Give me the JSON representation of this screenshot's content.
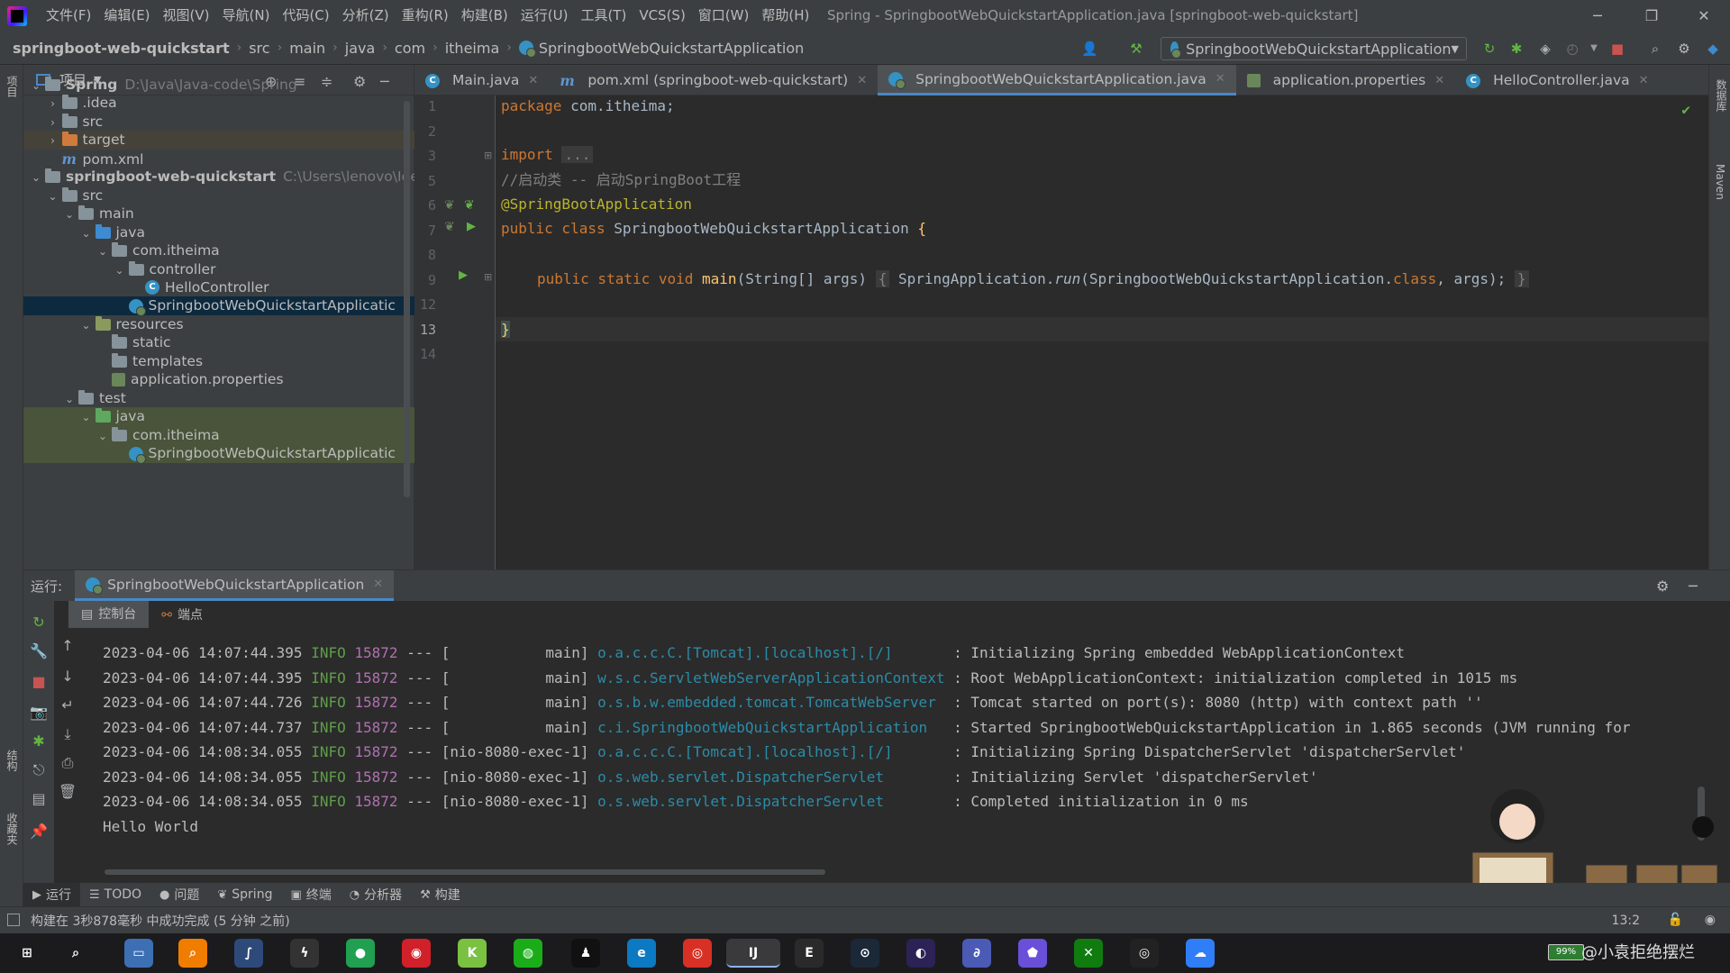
{
  "titlebar": {
    "menus": [
      "文件(F)",
      "编辑(E)",
      "视图(V)",
      "导航(N)",
      "代码(C)",
      "分析(Z)",
      "重构(R)",
      "构建(B)",
      "运行(U)",
      "工具(T)",
      "VCS(S)",
      "窗口(W)",
      "帮助(H)"
    ],
    "window_title": "Spring - SpringbootWebQuickstartApplication.java [springboot-web-quickstart]"
  },
  "navbar": {
    "breadcrumbs": [
      "springboot-web-quickstart",
      "src",
      "main",
      "java",
      "com",
      "itheima",
      "SpringbootWebQuickstartApplication"
    ],
    "run_config": "SpringbootWebQuickstartApplication"
  },
  "left_strip": {
    "labels": [
      "项目",
      "结构",
      "收藏夹"
    ]
  },
  "right_strip": {
    "labels": [
      "数据库",
      "Maven"
    ]
  },
  "project": {
    "title": "项目",
    "tree": [
      {
        "label": "Spring",
        "path": "D:\\Java\\Java-code\\Spring",
        "depth": 0,
        "arrow": "v",
        "icon": "folder",
        "bold": true
      },
      {
        "label": ".idea",
        "depth": 1,
        "arrow": ">",
        "icon": "folder"
      },
      {
        "label": "src",
        "depth": 1,
        "arrow": ">",
        "icon": "folder"
      },
      {
        "label": "target",
        "depth": 1,
        "arrow": ">",
        "icon": "folder-orange",
        "style": "excluded"
      },
      {
        "label": "pom.xml",
        "depth": 1,
        "arrow": "",
        "icon": "maven"
      },
      {
        "label": "springboot-web-quickstart",
        "path": "C:\\Users\\lenovo\\IdeaPr",
        "depth": 0,
        "arrow": "v",
        "icon": "folder",
        "bold": true
      },
      {
        "label": "src",
        "depth": 1,
        "arrow": "v",
        "icon": "folder"
      },
      {
        "label": "main",
        "depth": 2,
        "arrow": "v",
        "icon": "folder"
      },
      {
        "label": "java",
        "depth": 3,
        "arrow": "v",
        "icon": "folder-blue"
      },
      {
        "label": "com.itheima",
        "depth": 4,
        "arrow": "v",
        "icon": "folder"
      },
      {
        "label": "controller",
        "depth": 5,
        "arrow": "v",
        "icon": "folder"
      },
      {
        "label": "HelloController",
        "depth": 6,
        "arrow": "",
        "icon": "class"
      },
      {
        "label": "SpringbootWebQuickstartApplicatic",
        "depth": 6,
        "arrow": "",
        "icon": "spring",
        "style": "selected",
        "indent_override": 5
      },
      {
        "label": "resources",
        "depth": 3,
        "arrow": "v",
        "icon": "folder-res"
      },
      {
        "label": "static",
        "depth": 4,
        "arrow": "",
        "icon": "folder"
      },
      {
        "label": "templates",
        "depth": 4,
        "arrow": "",
        "icon": "folder"
      },
      {
        "label": "application.properties",
        "depth": 4,
        "arrow": "",
        "icon": "props"
      },
      {
        "label": "test",
        "depth": 2,
        "arrow": "v",
        "icon": "folder"
      },
      {
        "label": "java",
        "depth": 3,
        "arrow": "v",
        "icon": "folder-green",
        "style": "test"
      },
      {
        "label": "com.itheima",
        "depth": 4,
        "arrow": "v",
        "icon": "folder",
        "style": "test"
      },
      {
        "label": "SpringbootWebQuickstartApplicatic",
        "depth": 5,
        "arrow": "",
        "icon": "spring",
        "style": "test"
      }
    ]
  },
  "editor": {
    "tabs": [
      {
        "label": "Main.java",
        "icon": "class",
        "active": false
      },
      {
        "label": "pom.xml (springboot-web-quickstart)",
        "icon": "maven",
        "active": false
      },
      {
        "label": "SpringbootWebQuickstartApplication.java",
        "icon": "spring",
        "active": true
      },
      {
        "label": "application.properties",
        "icon": "props",
        "active": false
      },
      {
        "label": "HelloController.java",
        "icon": "class",
        "active": false
      }
    ],
    "line_numbers": [
      "1",
      "2",
      "3",
      "5",
      "6",
      "7",
      "8",
      "9",
      "12",
      "13",
      "14"
    ],
    "current_line": "13",
    "code": {
      "l1_kw": "package",
      "l1_rest": " com.itheima;",
      "l3_kw": "import",
      "l3_fold": "...",
      "l5_comment": "//启动类 -- 启动SpringBoot工程",
      "l6_annotation": "@SpringBootApplication",
      "l7_kw": "public class",
      "l7_name": " SpringbootWebQuickstartApplication ",
      "l7_brace": "{",
      "l9_kw": "public static void",
      "l9_fn": "main",
      "l9_args": "(String[] args) ",
      "l9_fold_open": "{",
      "l9_call": " SpringApplication.",
      "l9_run": "run",
      "l9_params": "(SpringbootWebQuickstartApplication.",
      "l9_class": "class",
      "l9_tail": ", args);",
      "l9_fold_close": "}",
      "l13_brace": "}"
    }
  },
  "run": {
    "label": "运行:",
    "tab": "SpringbootWebQuickstartApplication",
    "subtabs": [
      "控制台",
      "端点"
    ],
    "logs": [
      {
        "ts": "2023-04-06 14:07:44.395",
        "level": "INFO",
        "pid": "15872",
        "sep": "---",
        "thread": "[           main]",
        "logger": "o.a.c.c.C.[Tomcat].[localhost].[/]      ",
        "msg": ": Initializing Spring embedded WebApplicationContext"
      },
      {
        "ts": "2023-04-06 14:07:44.395",
        "level": "INFO",
        "pid": "15872",
        "sep": "---",
        "thread": "[           main]",
        "logger": "w.s.c.ServletWebServerApplicationContext",
        "msg": ": Root WebApplicationContext: initialization completed in 1015 ms"
      },
      {
        "ts": "2023-04-06 14:07:44.726",
        "level": "INFO",
        "pid": "15872",
        "sep": "---",
        "thread": "[           main]",
        "logger": "o.s.b.w.embedded.tomcat.TomcatWebServer ",
        "msg": ": Tomcat started on port(s): 8080 (http) with context path ''"
      },
      {
        "ts": "2023-04-06 14:07:44.737",
        "level": "INFO",
        "pid": "15872",
        "sep": "---",
        "thread": "[           main]",
        "logger": "c.i.SpringbootWebQuickstartApplication  ",
        "msg": ": Started SpringbootWebQuickstartApplication in 1.865 seconds (JVM running for"
      },
      {
        "ts": "2023-04-06 14:08:34.055",
        "level": "INFO",
        "pid": "15872",
        "sep": "---",
        "thread": "[nio-8080-exec-1]",
        "logger": "o.a.c.c.C.[Tomcat].[localhost].[/]      ",
        "msg": ": Initializing Spring DispatcherServlet 'dispatcherServlet'"
      },
      {
        "ts": "2023-04-06 14:08:34.055",
        "level": "INFO",
        "pid": "15872",
        "sep": "---",
        "thread": "[nio-8080-exec-1]",
        "logger": "o.s.web.servlet.DispatcherServlet       ",
        "msg": ": Initializing Servlet 'dispatcherServlet'"
      },
      {
        "ts": "2023-04-06 14:08:34.055",
        "level": "INFO",
        "pid": "15872",
        "sep": "---",
        "thread": "[nio-8080-exec-1]",
        "logger": "o.s.web.servlet.DispatcherServlet       ",
        "msg": ": Completed initialization in 0 ms"
      }
    ],
    "output": "Hello World"
  },
  "bottom_tabs": [
    {
      "label": "运行",
      "icon": "▶",
      "active": true
    },
    {
      "label": "TODO",
      "icon": "☰",
      "active": false
    },
    {
      "label": "问题",
      "icon": "●",
      "active": false
    },
    {
      "label": "Spring",
      "icon": "❦",
      "active": false
    },
    {
      "label": "终端",
      "icon": "▣",
      "active": false
    },
    {
      "label": "分析器",
      "icon": "◔",
      "active": false
    },
    {
      "label": "构建",
      "icon": "⚒",
      "active": false
    }
  ],
  "status": {
    "message": "构建在 3秒878毫秒 中成功完成 (5 分钟 之前)",
    "cursor": "13:2"
  },
  "taskbar": {
    "tray_text": "@小袁拒绝摆烂",
    "battery": "99%",
    "apps": [
      "windows-icon",
      "search-icon",
      "explorer-icon",
      "everything-icon",
      "obsidian-icon",
      "thunder-icon",
      "green-app-icon",
      "netease-music-icon",
      "kook-icon",
      "wechat-icon",
      "qq-icon",
      "edge-icon",
      "chrome-icon",
      "intellij-icon",
      "epic-games-icon",
      "steam-icon",
      "eclipse-icon",
      "dolphin-icon",
      "pentagon-app-icon",
      "xbox-icon",
      "ubisoft-icon",
      "baidu-netdisk-icon"
    ]
  },
  "colors": {
    "accent": "#4a88c7",
    "bg_editor": "#2b2b2b",
    "bg_panel": "#3c3f41",
    "keyword": "#cc7832",
    "annotation": "#bbb529",
    "log_level": "#5f9e4a",
    "logger": "#2b8ca8"
  }
}
